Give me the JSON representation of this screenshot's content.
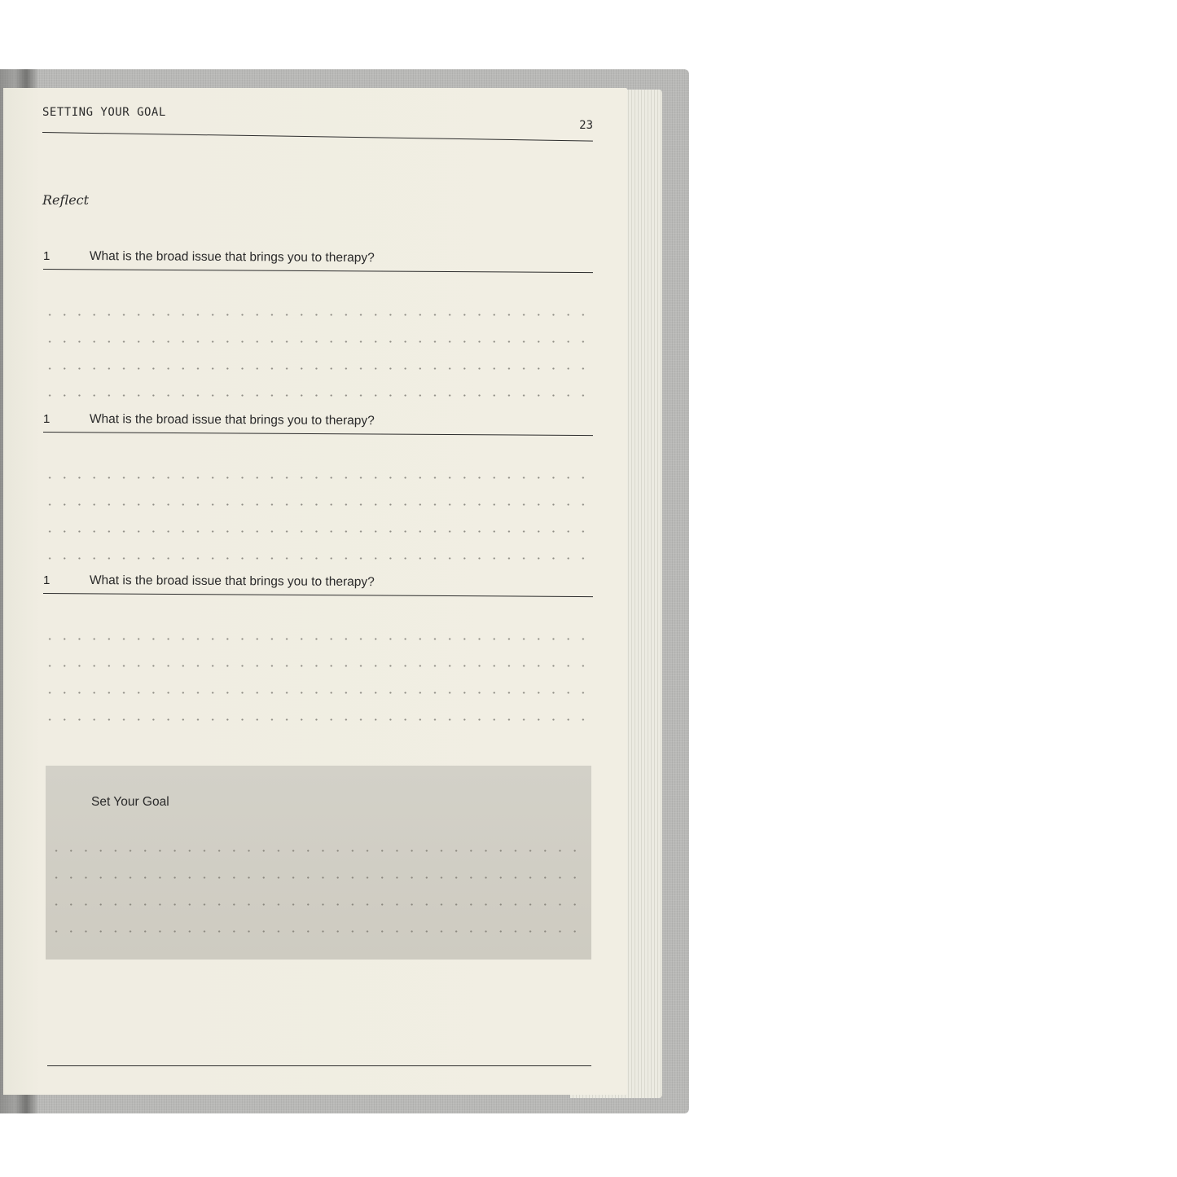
{
  "page": {
    "running_head": "SETTING YOUR GOAL",
    "page_number": "23",
    "section_label": "Reflect",
    "questions": [
      {
        "number": "1",
        "text": "What is the broad issue that brings you to therapy?"
      },
      {
        "number": "1",
        "text": "What is the broad issue that brings you to therapy?"
      },
      {
        "number": "1",
        "text": "What is the broad issue that brings you to therapy?"
      }
    ],
    "goal_box": {
      "title": "Set Your Goal"
    }
  },
  "colors": {
    "paper": "#f1eee3",
    "cover": "#b9b9b7",
    "goal_box": "#d1cfc5",
    "ink": "#2c2c2c"
  }
}
